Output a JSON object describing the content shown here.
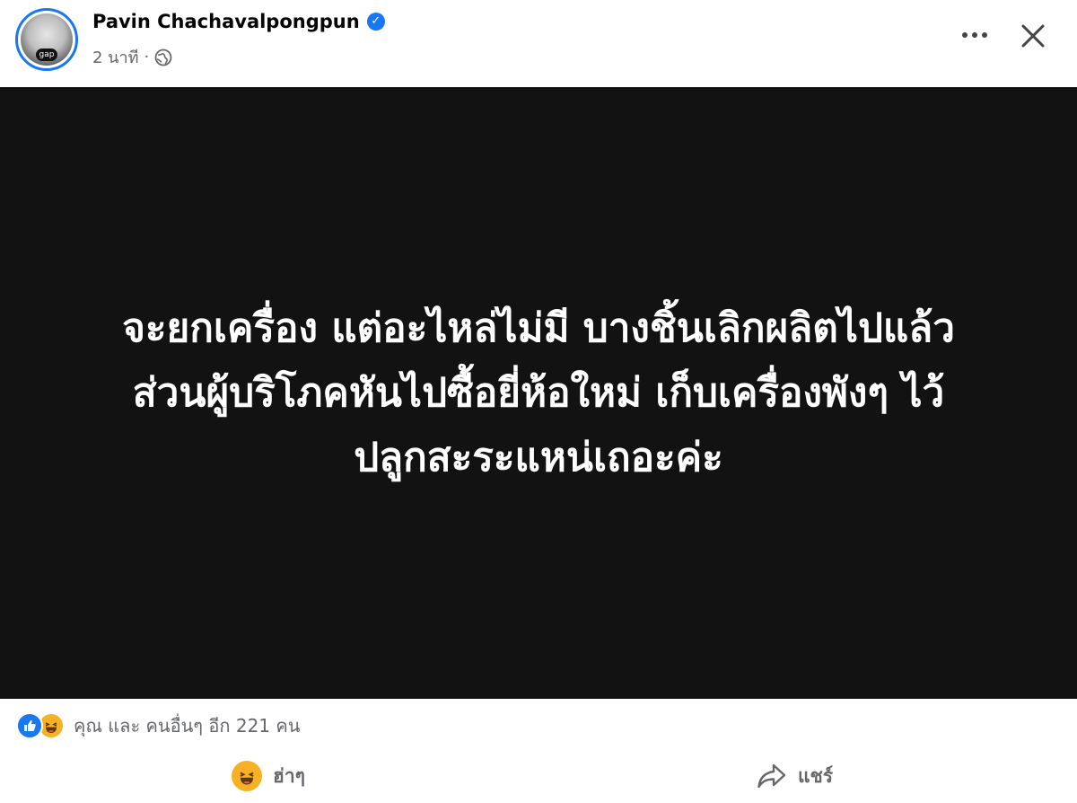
{
  "post": {
    "author": "Pavin Chachavalpongpun",
    "verified_icon": "verified-badge-icon",
    "time": "2 นาที",
    "separator": "·",
    "audience_icon": "globe-icon",
    "avatar_badge": "gap",
    "text_lines": [
      "จะยกเครื่อง แต่อะไหล่ไม่มี บางชิ้นเลิกผลิตไปแล้ว",
      "ส่วนผู้บริโภคหันไปซื้อยี่ห้อใหม่ เก็บเครื่องพังๆ ไว้",
      "ปลูกสะระแหน่เถอะค่ะ"
    ],
    "image_background": "#121212"
  },
  "header": {
    "more_icon": "more-horizontal-icon",
    "close_icon": "close-icon"
  },
  "reactions": {
    "icons": [
      "like-icon",
      "haha-icon"
    ],
    "summary": "คุณ และ คนอื่นๆ อีก 221 คน"
  },
  "actions": {
    "haha_label": "ฮ่าๆ",
    "share_label": "แชร์"
  },
  "colors": {
    "accent": "#1877f2",
    "haha": "#f7b125",
    "secondary_text": "#65676b"
  }
}
